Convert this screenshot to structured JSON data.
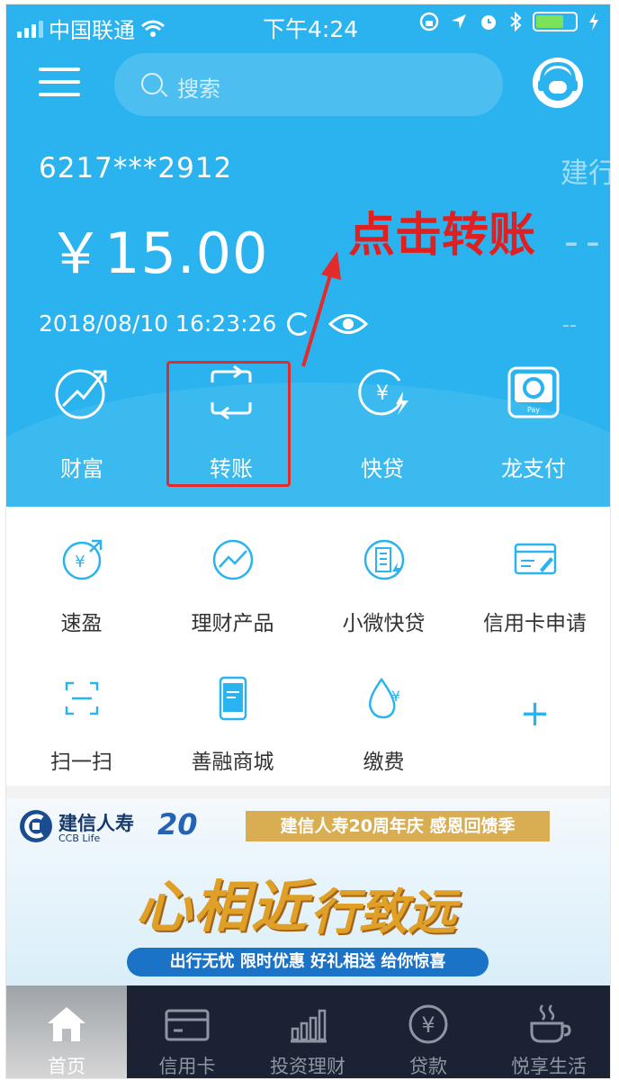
{
  "status": {
    "carrier": "中国联通",
    "time": "下午4:24"
  },
  "search": {
    "placeholder": "搜索"
  },
  "account": {
    "card_number": "6217***2912",
    "balance": "￥15.00",
    "timestamp": "2018/08/10 16:23:26",
    "next_card_peek": "建行",
    "next_balance_peek": "--",
    "next_time_peek": "--"
  },
  "annotation": {
    "text": "点击转账",
    "color": "#e02020"
  },
  "quick_actions": [
    {
      "label": "财富",
      "icon": "wealth-chart-icon"
    },
    {
      "label": "转账",
      "icon": "transfer-icon"
    },
    {
      "label": "快贷",
      "icon": "quick-loan-icon"
    },
    {
      "label": "龙支付",
      "icon": "long-pay-icon"
    }
  ],
  "grid": [
    {
      "label": "速盈",
      "icon": "suying-icon"
    },
    {
      "label": "理财产品",
      "icon": "wealth-product-icon"
    },
    {
      "label": "小微快贷",
      "icon": "micro-loan-icon"
    },
    {
      "label": "信用卡申请",
      "icon": "credit-card-apply-icon"
    },
    {
      "label": "扫一扫",
      "icon": "scan-icon"
    },
    {
      "label": "善融商城",
      "icon": "mall-icon"
    },
    {
      "label": "缴费",
      "icon": "payment-icon"
    },
    {
      "label": "+",
      "icon": "add-icon"
    }
  ],
  "banner": {
    "brand": "建信人寿",
    "brand_en": "CCB Life",
    "anniversary": "20",
    "ribbon": "建信人寿20周年庆 感恩回馈季",
    "headline_1": "心相近",
    "headline_2": "行致远",
    "tagline": "出行无忧 限时优惠 好礼相送 给你惊喜"
  },
  "bottom_nav": [
    {
      "label": "首页",
      "icon": "home-icon",
      "active": true
    },
    {
      "label": "信用卡",
      "icon": "credit-card-icon",
      "active": false
    },
    {
      "label": "投资理财",
      "icon": "investment-icon",
      "active": false
    },
    {
      "label": "贷款",
      "icon": "loan-icon",
      "active": false
    },
    {
      "label": "悦享生活",
      "icon": "coffee-icon",
      "active": false
    }
  ],
  "colors": {
    "primary_blue": "#2ab3ee",
    "nav_bg": "#1b2233",
    "highlight_red": "#e42a2a",
    "battery_green": "#7be35a"
  }
}
